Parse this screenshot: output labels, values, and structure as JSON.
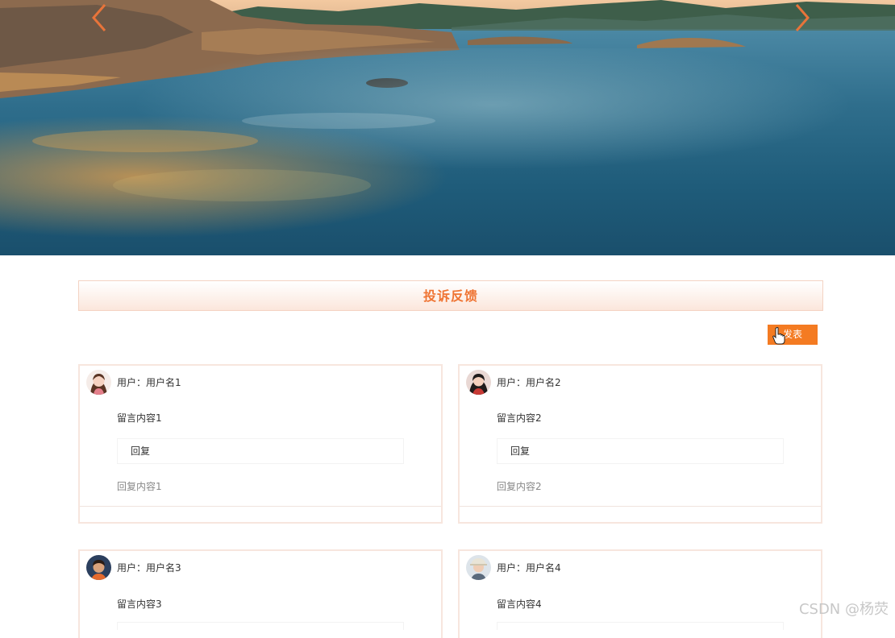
{
  "section": {
    "title": "投诉反馈",
    "publish_label": "发表"
  },
  "cards": [
    {
      "user_prefix": "用户：",
      "username": "用户名1",
      "message": "留言内容1",
      "reply_label": "回复",
      "reply_content": "回复内容1",
      "avatar": "female-avatar-icon"
    },
    {
      "user_prefix": "用户：",
      "username": "用户名2",
      "message": "留言内容2",
      "reply_label": "回复",
      "reply_content": "回复内容2",
      "avatar": "female-avatar-icon"
    },
    {
      "user_prefix": "用户：",
      "username": "用户名3",
      "message": "留言内容3",
      "avatar": "male-avatar-icon"
    },
    {
      "user_prefix": "用户：",
      "username": "用户名4",
      "message": "留言内容4",
      "avatar": "male-avatar-icon"
    }
  ],
  "icons": {
    "prev": "chevron-left-icon",
    "next": "chevron-right-icon"
  },
  "colors": {
    "accent": "#f47b22",
    "title": "#ef7433",
    "card_border": "#f7e6de"
  },
  "watermark": "CSDN @杨荧"
}
